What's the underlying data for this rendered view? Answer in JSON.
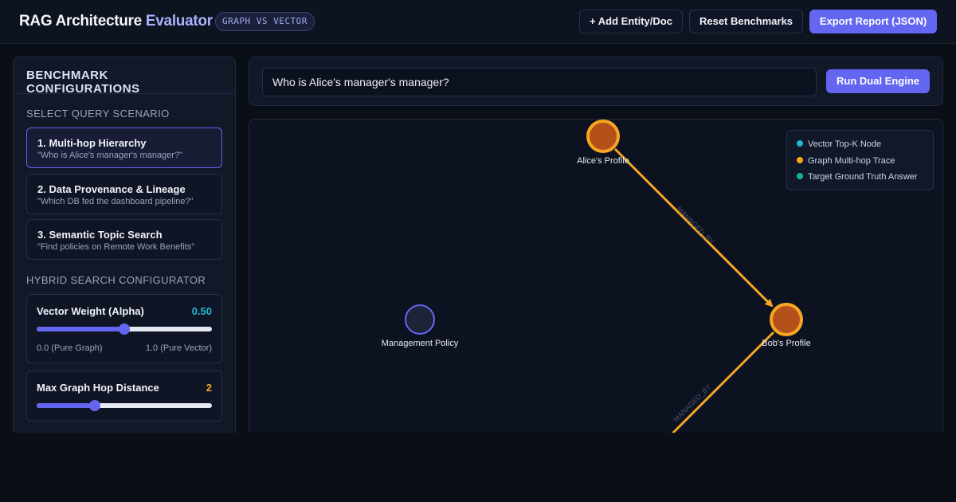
{
  "header": {
    "title_part1": "RAG Architecture",
    "title_part2": "Evaluator",
    "mode_badge": "GRAPH VS VECTOR",
    "add_button": "+ Add Entity/Doc",
    "reset_button": "Reset Benchmarks",
    "export_button": "Export Report (JSON)"
  },
  "sidebar": {
    "title": "BENCHMARK CONFIGURATIONS",
    "scenario_section_label": "SELECT QUERY SCENARIO",
    "scenarios": [
      {
        "title": "1. Multi-hop Hierarchy",
        "query": "\"Who is Alice's manager's manager?\"",
        "active": true
      },
      {
        "title": "2. Data Provenance & Lineage",
        "query": "\"Which DB fed the dashboard pipeline?\"",
        "active": false
      },
      {
        "title": "3. Semantic Topic Search",
        "query": "\"Find policies on Remote Work Benefits\"",
        "active": false
      }
    ],
    "hybrid_section_label": "HYBRID SEARCH CONFIGURATOR",
    "vector_weight": {
      "label": "Vector Weight (Alpha)",
      "value_text": "0.50",
      "value": 0.5,
      "min_label": "0.0 (Pure Graph)",
      "max_label": "1.0 (Pure Vector)",
      "color": "#22b8cf"
    },
    "max_hops": {
      "label": "Max Graph Hop Distance",
      "value_text": "2",
      "value": 2,
      "min": 0,
      "max": 6,
      "color": "#f5a623"
    }
  },
  "query": {
    "value": "Who is Alice's manager's manager?",
    "run_button": "Run Dual Engine"
  },
  "graph": {
    "nodes": [
      {
        "id": "alice",
        "label": "Alice's Profile",
        "role": "graph-trace"
      },
      {
        "id": "bob",
        "label": "Bob's Profile",
        "role": "graph-trace"
      },
      {
        "id": "policy",
        "label": "Management Policy",
        "role": "neutral"
      }
    ],
    "edges": [
      {
        "from": "alice",
        "to": "bob",
        "label": "MANAGED_BY"
      },
      {
        "from": "bob",
        "to": "offscreen",
        "label": "MANAGED_BY"
      }
    ],
    "legend": [
      {
        "label": "Vector Top-K Node",
        "color": "#22b8cf"
      },
      {
        "label": "Graph Multi-hop Trace",
        "color": "#f5a623"
      },
      {
        "label": "Target Ground Truth Answer",
        "color": "#10b981"
      }
    ],
    "colors": {
      "trace": "#f5a623",
      "trace_fill": "#b4501a",
      "neutral_stroke": "#6366f1",
      "neutral_fill": "#1d2438",
      "accent": "#6366f1"
    }
  }
}
